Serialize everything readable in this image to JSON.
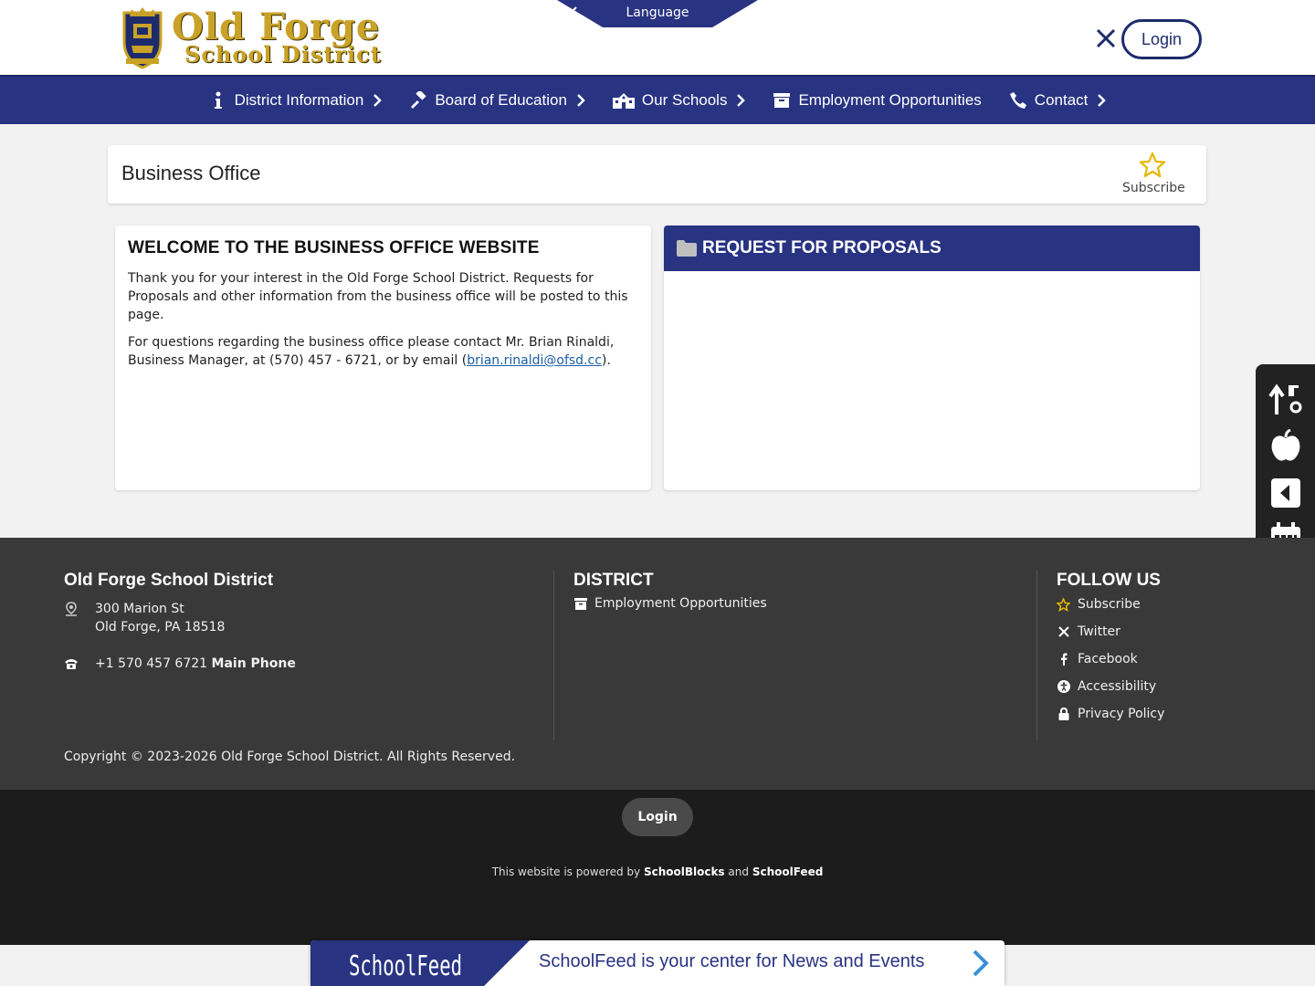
{
  "header": {
    "logo_text_line1": "Old Forge",
    "logo_text_line2": "School District",
    "language_label": "Language",
    "login_label": "Login",
    "icons": [
      "x-twitter-icon",
      "facebook-icon",
      "search-icon"
    ]
  },
  "nav": {
    "items": [
      {
        "label": "District Information",
        "icon": "info-icon"
      },
      {
        "label": "Board of Education",
        "icon": "gavel-icon"
      },
      {
        "label": "Our Schools",
        "icon": "school-icon"
      },
      {
        "label": "Employment Opportunities",
        "icon": "archive-icon"
      },
      {
        "label": "Contact",
        "icon": "phone-icon"
      }
    ]
  },
  "page": {
    "title": "Business Office",
    "subscribe_label": "Subscribe"
  },
  "welcome": {
    "heading": "WELCOME TO THE BUSINESS OFFICE WEBSITE",
    "para1": "Thank you for your interest in the Old Forge School District.  Requests for Proposals and other information from the business office will be posted to this page.",
    "para2_prefix": "For questions regarding the business office please contact Mr. Brian Rinaldi, Business Manager, at (570) 457 - 6721, or by email (",
    "para2_link": "brian.rinaldi@ofsd.cc",
    "para2_suffix": ")."
  },
  "rfp": {
    "heading": "REQUEST FOR PROPOSALS"
  },
  "rail": {
    "icons": [
      "sort-icon",
      "apple-icon",
      "caret-left-icon",
      "calendar-icon",
      "binoculars-icon"
    ]
  },
  "footer": {
    "org_name": "Old Forge School District",
    "address_line1": "300 Marion St",
    "address_line2": "Old Forge, PA 18518",
    "phone_number": "+1 570 457 6721",
    "phone_label": "Main Phone",
    "district_heading": "DISTRICT",
    "district_links": [
      "Employment Opportunities"
    ],
    "follow_heading": "FOLLOW US",
    "follow_links": [
      {
        "label": "Subscribe",
        "icon": "star-icon"
      },
      {
        "label": "Twitter",
        "icon": "x-twitter-icon"
      },
      {
        "label": "Facebook",
        "icon": "facebook-icon"
      },
      {
        "label": "Accessibility",
        "icon": "accessibility-icon"
      },
      {
        "label": "Privacy Policy",
        "icon": "lock-icon"
      }
    ],
    "copyright": "Copyright © 2023-2026 Old Forge School District. All Rights Reserved."
  },
  "bottom": {
    "login_label": "Login",
    "powered_prefix": "This website is powered by",
    "powered_brand1": "SchoolBlocks",
    "powered_and": "and",
    "powered_brand2": "SchoolFeed"
  },
  "feedbar": {
    "brand": "SchoolFeed",
    "text": "SchoolFeed is your center for News and Events"
  },
  "colors": {
    "primary_navy": "#283382",
    "gold": "#c9a227",
    "footer_bg": "#393939",
    "bottom_bg": "#1c1c1c"
  }
}
